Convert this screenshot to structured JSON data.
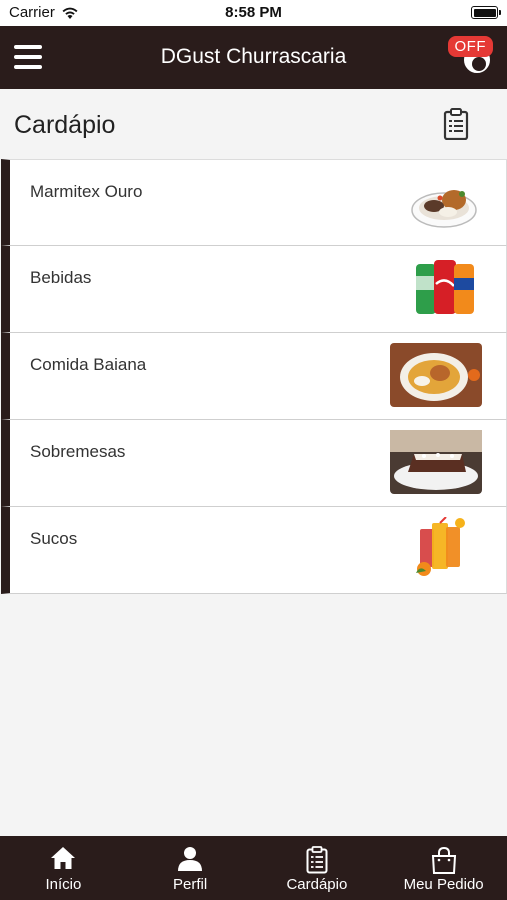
{
  "status_bar": {
    "carrier": "Carrier",
    "time": "8:58 PM"
  },
  "navbar": {
    "title": "DGust Churrascaria",
    "status_badge": "OFF"
  },
  "page": {
    "title": "Cardápio"
  },
  "menu": {
    "items": [
      {
        "label": "Marmitex Ouro",
        "image": "marmitex-plate-image"
      },
      {
        "label": "Bebidas",
        "image": "soda-cans-image"
      },
      {
        "label": "Comida Baiana",
        "image": "baiana-dish-image"
      },
      {
        "label": "Sobremesas",
        "image": "cake-slice-image"
      },
      {
        "label": "Sucos",
        "image": "juice-glasses-image"
      }
    ]
  },
  "tabbar": {
    "tabs": [
      {
        "label": "Início",
        "icon": "home-icon"
      },
      {
        "label": "Perfil",
        "icon": "person-icon"
      },
      {
        "label": "Cardápio",
        "icon": "clipboard-icon"
      },
      {
        "label": "Meu Pedido",
        "icon": "shopping-bag-icon"
      }
    ]
  },
  "colors": {
    "brand_dark": "#2a1c1b",
    "off_badge": "#e53935",
    "background": "#f4f4f4"
  }
}
